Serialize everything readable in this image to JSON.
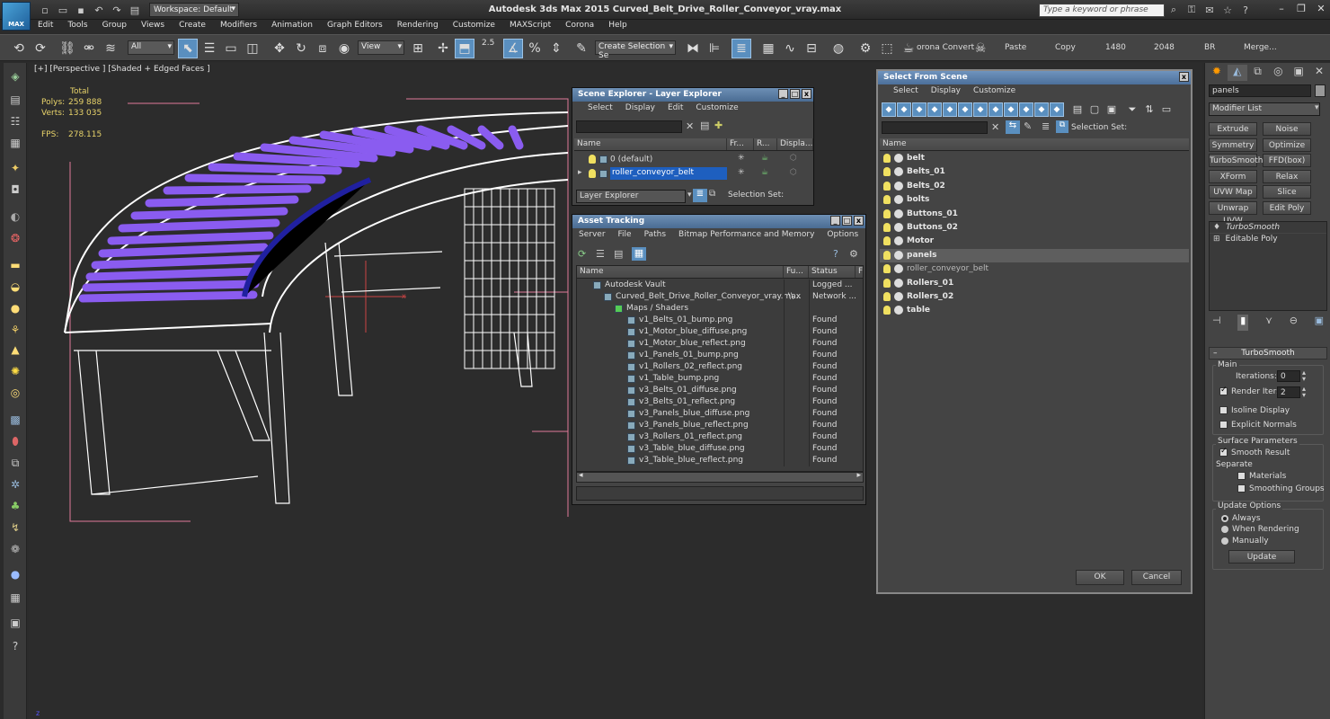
{
  "app": {
    "logo": "MAX",
    "workspace": "Workspace: Default",
    "title": "Autodesk 3ds Max 2015    Curved_Belt_Drive_Roller_Conveyor_vray.max",
    "search_placeholder": "Type a keyword or phrase"
  },
  "menus": [
    "Edit",
    "Tools",
    "Group",
    "Views",
    "Create",
    "Modifiers",
    "Animation",
    "Graph Editors",
    "Rendering",
    "Customize",
    "MAXScript",
    "Corona",
    "Help"
  ],
  "toolbar": {
    "filter": "All",
    "refcoord": "View",
    "snap_value": "2.5",
    "selection_set": "Create Selection Se",
    "texts": [
      "orona Convert",
      "Paste",
      "Copy",
      "1480",
      "2048",
      "BR",
      "Merge..."
    ]
  },
  "viewport": {
    "label": "[+] [Perspective ] [Shaded + Edged Faces ]",
    "stats": {
      "total_label": "Total",
      "polys_label": "Polys:",
      "polys": "259 888",
      "verts_label": "Verts:",
      "verts": "133 035",
      "fps_label": "FPS:",
      "fps": "278.115"
    },
    "axis_x": "x"
  },
  "scene_explorer": {
    "title": "Scene Explorer - Layer Explorer",
    "menus": [
      "Select",
      "Display",
      "Edit",
      "Customize"
    ],
    "cols": [
      "Name",
      "Fr...",
      "R...",
      "Displa..."
    ],
    "rows": [
      "0 (default)",
      "roller_conveyor_belt"
    ],
    "mode": "Layer Explorer",
    "selset_label": "Selection Set:"
  },
  "asset_tracking": {
    "title": "Asset Tracking",
    "menus": [
      "Server",
      "File",
      "Paths",
      "Bitmap Performance and Memory",
      "Options"
    ],
    "cols": [
      "Name",
      "Fu...",
      "Status",
      "F"
    ],
    "rows": [
      {
        "name": "Autodesk Vault",
        "fu": "",
        "status": "Logged ..."
      },
      {
        "name": "Curved_Belt_Drive_Roller_Conveyor_vray.max",
        "fu": "\\\\...",
        "status": "Network ..."
      },
      {
        "name": "Maps / Shaders",
        "fu": "",
        "status": ""
      },
      {
        "name": "v1_Belts_01_bump.png",
        "fu": "",
        "status": "Found"
      },
      {
        "name": "v1_Motor_blue_diffuse.png",
        "fu": "",
        "status": "Found"
      },
      {
        "name": "v1_Motor_blue_reflect.png",
        "fu": "",
        "status": "Found"
      },
      {
        "name": "v1_Panels_01_bump.png",
        "fu": "",
        "status": "Found"
      },
      {
        "name": "v1_Rollers_02_reflect.png",
        "fu": "",
        "status": "Found"
      },
      {
        "name": "v1_Table_bump.png",
        "fu": "",
        "status": "Found"
      },
      {
        "name": "v3_Belts_01_diffuse.png",
        "fu": "",
        "status": "Found"
      },
      {
        "name": "v3_Belts_01_reflect.png",
        "fu": "",
        "status": "Found"
      },
      {
        "name": "v3_Panels_blue_diffuse.png",
        "fu": "",
        "status": "Found"
      },
      {
        "name": "v3_Panels_blue_reflect.png",
        "fu": "",
        "status": "Found"
      },
      {
        "name": "v3_Rollers_01_reflect.png",
        "fu": "",
        "status": "Found"
      },
      {
        "name": "v3_Table_blue_diffuse.png",
        "fu": "",
        "status": "Found"
      },
      {
        "name": "v3_Table_blue_reflect.png",
        "fu": "",
        "status": "Found"
      }
    ]
  },
  "select_from_scene": {
    "title": "Select From Scene",
    "menus": [
      "Select",
      "Display",
      "Customize"
    ],
    "selset_label": "Selection Set:",
    "col": "Name",
    "items": [
      "belt",
      "Belts_01",
      "Belts_02",
      "bolts",
      "Buttons_01",
      "Buttons_02",
      "Motor",
      "panels",
      "roller_conveyor_belt",
      "Rollers_01",
      "Rollers_02",
      "table"
    ],
    "selected": "panels",
    "ok": "OK",
    "cancel": "Cancel"
  },
  "command_panel": {
    "object_name": "panels",
    "modifier_list": "Modifier List",
    "buttons": [
      "Extrude",
      "Noise",
      "Symmetry",
      "Optimize",
      "TurboSmooth",
      "FFD(box)",
      "XForm",
      "Relax",
      "UVW Map",
      "Slice",
      "Unwrap UVW",
      "Edit Poly"
    ],
    "stack": [
      "TurboSmooth",
      "Editable Poly"
    ],
    "rollout": "TurboSmooth",
    "main": "Main",
    "iterations_label": "Iterations:",
    "iterations": "0",
    "render_iters_label": "Render Iters:",
    "render_iters": "2",
    "isoline": "Isoline Display",
    "explicit": "Explicit Normals",
    "surface_params": "Surface Parameters",
    "smooth_result": "Smooth Result",
    "separate": "Separate",
    "materials": "Materials",
    "smoothing_groups": "Smoothing Groups",
    "update_options": "Update Options",
    "always": "Always",
    "when_rendering": "When Rendering",
    "manually": "Manually",
    "update": "Update"
  },
  "colors": {
    "accent": "#5a8fbf",
    "selection": "#1e5fbf",
    "stats": "#e8d36a",
    "rollers": "#8a5cf0",
    "frame": "#ffffff"
  }
}
